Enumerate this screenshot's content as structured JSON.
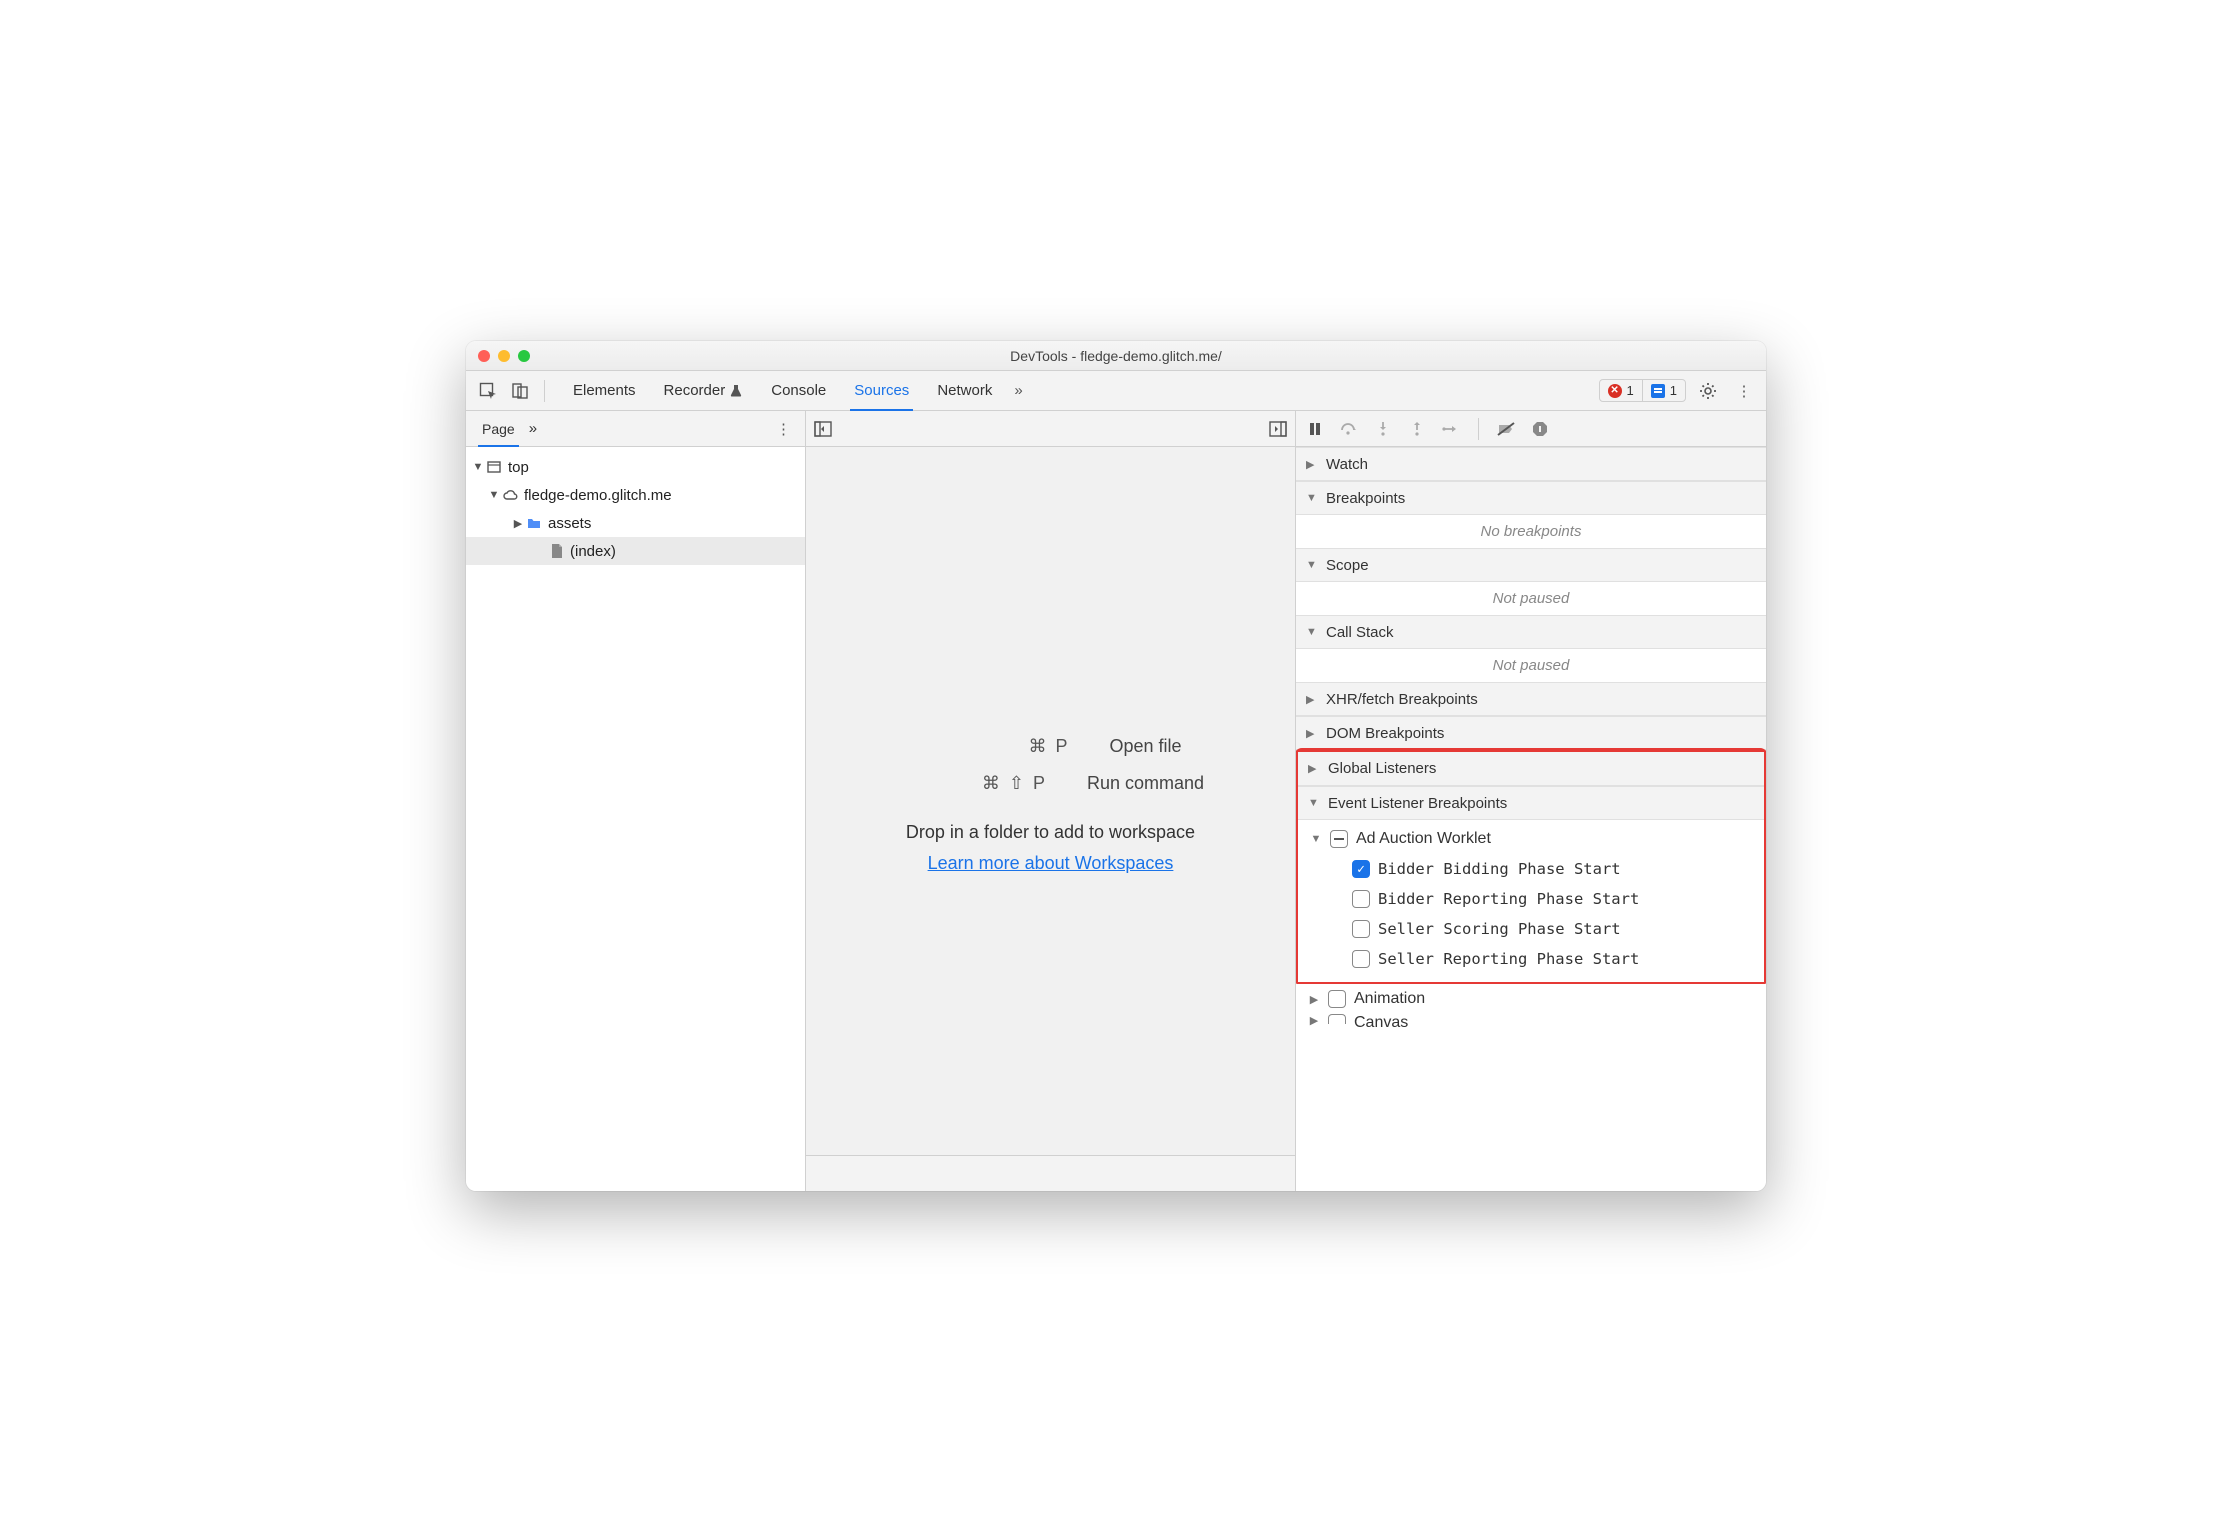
{
  "window": {
    "title": "DevTools - fledge-demo.glitch.me/"
  },
  "toolbar": {
    "tabs": [
      "Elements",
      "Recorder",
      "Console",
      "Sources",
      "Network"
    ],
    "active_tab": "Sources",
    "errors_count": "1",
    "messages_count": "1"
  },
  "navigator": {
    "active_subtab": "Page",
    "tree": {
      "top": "top",
      "domain": "fledge-demo.glitch.me",
      "folder": "assets",
      "file": "(index)"
    }
  },
  "editor": {
    "shortcuts": [
      {
        "keys": "⌘ P",
        "desc": "Open file"
      },
      {
        "keys": "⌘ ⇧ P",
        "desc": "Run command"
      }
    ],
    "drop_hint": "Drop in a folder to add to workspace",
    "link_text": "Learn more about Workspaces"
  },
  "debugger": {
    "sections": {
      "watch": "Watch",
      "breakpoints": {
        "label": "Breakpoints",
        "empty": "No breakpoints"
      },
      "scope": {
        "label": "Scope",
        "empty": "Not paused"
      },
      "callstack": {
        "label": "Call Stack",
        "empty": "Not paused"
      },
      "xhr": "XHR/fetch Breakpoints",
      "dom": "DOM Breakpoints",
      "global": "Global Listeners",
      "elb": "Event Listener Breakpoints"
    },
    "elb": {
      "group": "Ad Auction Worklet",
      "items": [
        {
          "label": "Bidder Bidding Phase Start",
          "checked": true
        },
        {
          "label": "Bidder Reporting Phase Start",
          "checked": false
        },
        {
          "label": "Seller Scoring Phase Start",
          "checked": false
        },
        {
          "label": "Seller Reporting Phase Start",
          "checked": false
        }
      ],
      "next_group": "Animation",
      "after_group": "Canvas"
    }
  }
}
